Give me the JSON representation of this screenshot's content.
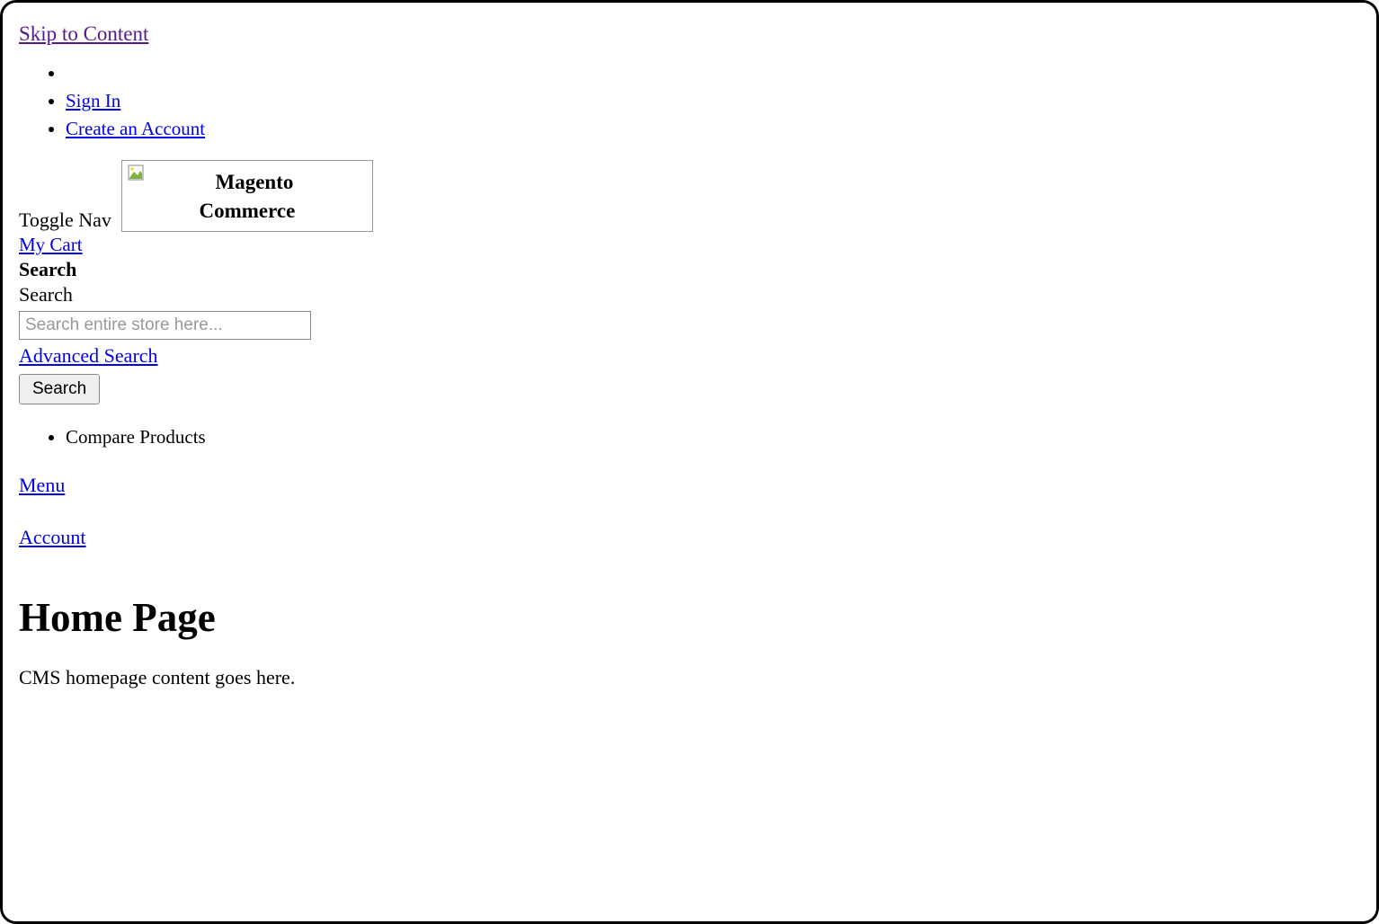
{
  "skip_to_content": "Skip to Content",
  "header_links": {
    "sign_in": "Sign In",
    "create_account": "Create an Account"
  },
  "toggle_nav": "Toggle Nav",
  "logo": {
    "line1": "Magento",
    "line2": "Commerce"
  },
  "my_cart": "My Cart",
  "search": {
    "bold_label": "Search",
    "label": "Search",
    "placeholder": "Search entire store here...",
    "advanced": "Advanced Search",
    "button": "Search"
  },
  "compare_products": "Compare Products",
  "menu": "Menu",
  "account": "Account",
  "page_title": "Home Page",
  "cms_content": "CMS homepage content goes here."
}
